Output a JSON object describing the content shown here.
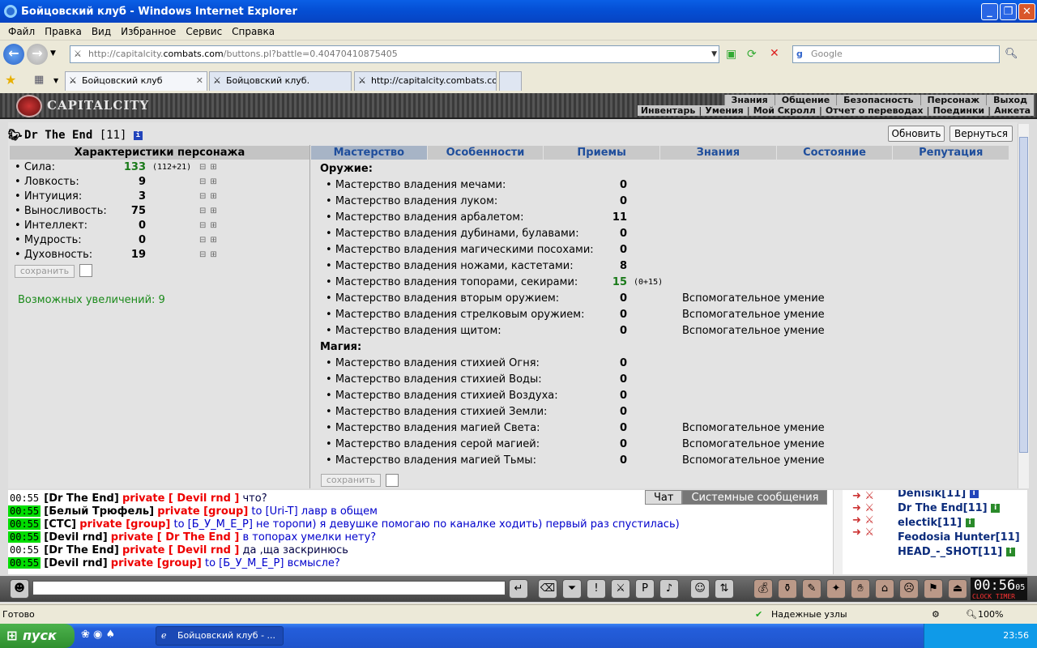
{
  "window": {
    "title": "Бойцовский клуб - Windows Internet Explorer"
  },
  "menu": [
    "Файл",
    "Правка",
    "Вид",
    "Избранное",
    "Сервис",
    "Справка"
  ],
  "address": {
    "url_prefix": "http://capitalcity.",
    "url_domain": "combats.com",
    "url_path": "/buttons.pl?battle=0.40470410875405",
    "search_placeholder": "Google"
  },
  "tabs": [
    {
      "label": "Бойцовский клуб"
    },
    {
      "label": "Бойцовский клуб."
    },
    {
      "label": "http://capitalcity.combats.co..."
    }
  ],
  "site": {
    "logo": "CAPITALCITY",
    "nav_top": [
      "Знания",
      "Общение",
      "Безопасность",
      "Персонаж",
      "Выход"
    ],
    "nav_bottom": [
      "Инвентарь",
      "Умения",
      "Мой Скролл",
      "Отчет о переводах",
      "Поединки",
      "Анкета"
    ]
  },
  "character": {
    "name": "Dr The End",
    "level": "[11]",
    "info_icon": "i"
  },
  "buttons": {
    "refresh": "Обновить",
    "back": "Вернуться",
    "save": "сохранить"
  },
  "stats": {
    "header": "Характеристики персонажа",
    "items": [
      {
        "name": "Сила:",
        "value": "133",
        "extra": "(112+21)",
        "highlight": true
      },
      {
        "name": "Ловкость:",
        "value": "9",
        "extra": ""
      },
      {
        "name": "Интуиция:",
        "value": "3",
        "extra": ""
      },
      {
        "name": "Выносливость:",
        "value": "75",
        "extra": ""
      },
      {
        "name": "Интеллект:",
        "value": "0",
        "extra": ""
      },
      {
        "name": "Мудрость:",
        "value": "0",
        "extra": ""
      },
      {
        "name": "Духовность:",
        "value": "19",
        "extra": ""
      }
    ],
    "increments": "Возможных увеличений: 9"
  },
  "skill_tabs": [
    "Мастерство",
    "Особенности",
    "Приемы",
    "Знания",
    "Состояние",
    "Репутация"
  ],
  "skills": {
    "weapons_title": "Оружие:",
    "weapons": [
      {
        "name": "Мастерство владения мечами:",
        "value": "0",
        "extra": "",
        "note": ""
      },
      {
        "name": "Мастерство владения луком:",
        "value": "0",
        "extra": "",
        "note": ""
      },
      {
        "name": "Мастерство владения арбалетом:",
        "value": "11",
        "extra": "",
        "note": ""
      },
      {
        "name": "Мастерство владения дубинами, булавами:",
        "value": "0",
        "extra": "",
        "note": ""
      },
      {
        "name": "Мастерство владения магическими посохами:",
        "value": "0",
        "extra": "",
        "note": ""
      },
      {
        "name": "Мастерство владения ножами, кастетами:",
        "value": "8",
        "extra": "",
        "note": ""
      },
      {
        "name": "Мастерство владения топорами, секирами:",
        "value": "15",
        "extra": "(0+15)",
        "note": "",
        "highlight": true
      },
      {
        "name": "Мастерство владения вторым оружием:",
        "value": "0",
        "extra": "",
        "note": "Вспомогательное умение"
      },
      {
        "name": "Мастерство владения стрелковым оружием:",
        "value": "0",
        "extra": "",
        "note": "Вспомогательное умение"
      },
      {
        "name": "Мастерство владения щитом:",
        "value": "0",
        "extra": "",
        "note": "Вспомогательное умение"
      }
    ],
    "magic_title": "Магия:",
    "magic": [
      {
        "name": "Мастерство владения стихией Огня:",
        "value": "0",
        "extra": "",
        "note": ""
      },
      {
        "name": "Мастерство владения стихией Воды:",
        "value": "0",
        "extra": "",
        "note": ""
      },
      {
        "name": "Мастерство владения стихией Воздуха:",
        "value": "0",
        "extra": "",
        "note": ""
      },
      {
        "name": "Мастерство владения стихией Земли:",
        "value": "0",
        "extra": "",
        "note": ""
      },
      {
        "name": "Мастерство владения магией Света:",
        "value": "0",
        "extra": "",
        "note": "Вспомогательное умение"
      },
      {
        "name": "Мастерство владения серой магией:",
        "value": "0",
        "extra": "",
        "note": "Вспомогательное умение"
      },
      {
        "name": "Мастерство владения магией Тьмы:",
        "value": "0",
        "extra": "",
        "note": "Вспомогательное умение"
      }
    ]
  },
  "chat": {
    "tabs": [
      "Чат",
      "Системные сообщения"
    ],
    "messages": [
      {
        "time": "00:55",
        "hl": false,
        "nick": "[Dr The End]",
        "priv": "private [ Devil rnd ]",
        "text": "что?",
        "blue": false
      },
      {
        "time": "00:55",
        "hl": true,
        "nick": "[Белый Трюфель]",
        "priv": "private [group]",
        "text": "to [Uri-T] лавр в общем",
        "blue": true
      },
      {
        "time": "00:55",
        "hl": true,
        "nick": "[СТС]",
        "priv": "private [group]",
        "text": "to [Б_У_М_Е_Р] не торопи) я девушке помогаю по каналке ходить) первый раз спустилась)",
        "blue": true
      },
      {
        "time": "00:55",
        "hl": true,
        "nick": "[Devil rnd]",
        "priv": "private [ Dr The End ]",
        "text": "в топорах умелки нету?",
        "blue": true
      },
      {
        "time": "00:55",
        "hl": false,
        "nick": "[Dr The End]",
        "priv": "private [ Devil rnd ]",
        "text": "да ,ща заскринюсь",
        "blue": false
      },
      {
        "time": "00:55",
        "hl": true,
        "nick": "[Devil rnd]",
        "priv": "private [group]",
        "text": "to [Б_У_М_Е_Р] всмысле?",
        "blue": true
      }
    ]
  },
  "users": [
    {
      "name": "Denisik",
      "level": "[11]"
    },
    {
      "name": "Dr The End",
      "level": "[11]"
    },
    {
      "name": "electik",
      "level": "[11]"
    },
    {
      "name": "Feodosia Hunter",
      "level": "[11]"
    },
    {
      "name": "HEAD_-_SHOT",
      "level": "[11]"
    }
  ],
  "clock": {
    "time": "00:56",
    "sec": "05",
    "label": "CLOCK TIMER"
  },
  "statusbar": {
    "status": "Готово",
    "zone": "Надежные узлы",
    "zoom": "100%"
  },
  "taskbar": {
    "start": "пуск",
    "task": "Бойцовский клуб - ...",
    "time": "23:56"
  }
}
